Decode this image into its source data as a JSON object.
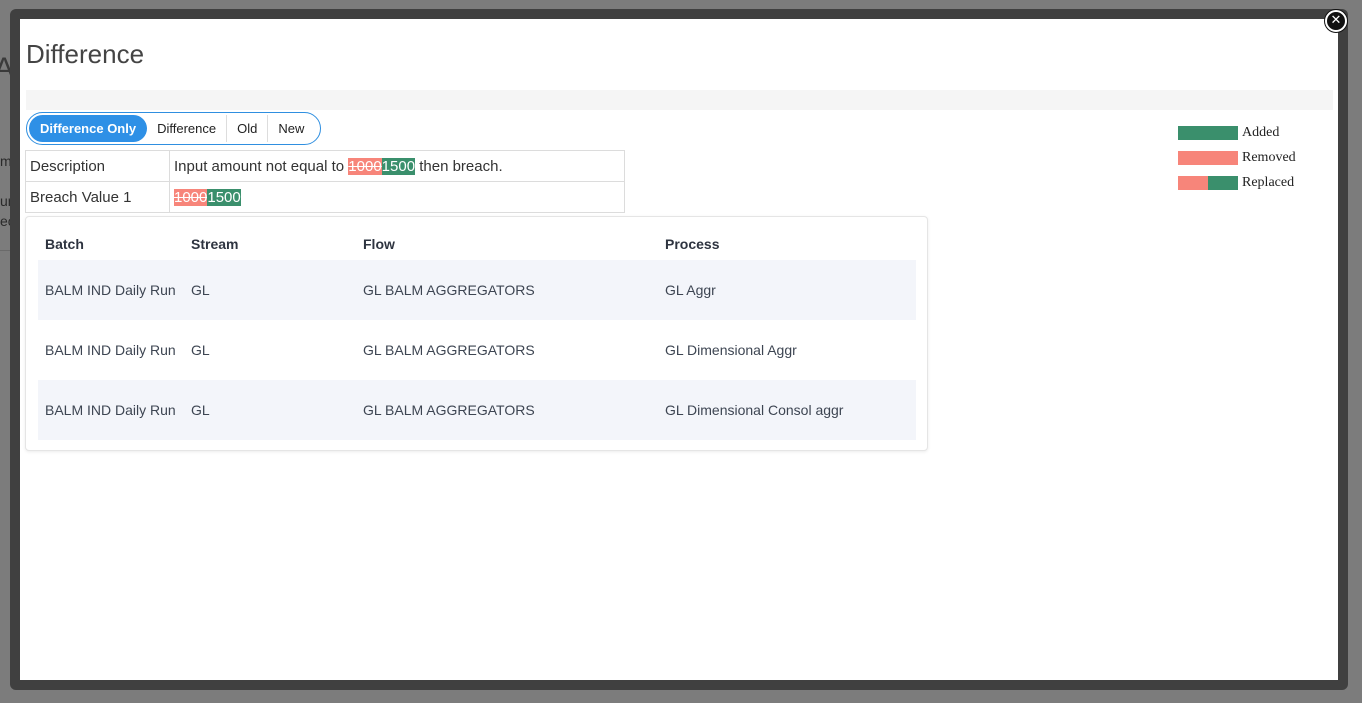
{
  "background": {
    "title": "Ap",
    "cells": [
      "me",
      "unt",
      "eck"
    ]
  },
  "modal": {
    "title": "Difference",
    "close_icon": "close-circle-icon"
  },
  "view_toggle": {
    "options": [
      "Difference Only",
      "Difference",
      "Old",
      "New"
    ],
    "selected": "Difference Only"
  },
  "diff": {
    "rows": [
      {
        "label": "Description",
        "prefix": "Input amount not equal to ",
        "removed": "1000",
        "added": "1500",
        "suffix": " then breach."
      },
      {
        "label": "Breach Value 1",
        "prefix": "",
        "removed": "1000",
        "added": "1500",
        "suffix": ""
      }
    ]
  },
  "batch_table": {
    "headers": [
      "Batch",
      "Stream",
      "Flow",
      "Process"
    ],
    "rows": [
      [
        "BALM IND Daily Run",
        "GL",
        "GL BALM AGGREGATORS",
        "GL Aggr"
      ],
      [
        "BALM IND Daily Run",
        "GL",
        "GL BALM AGGREGATORS",
        "GL Dimensional Aggr"
      ],
      [
        "BALM IND Daily Run",
        "GL",
        "GL BALM AGGREGATORS",
        "GL Dimensional Consol aggr"
      ]
    ]
  },
  "legend": {
    "added": "Added",
    "removed": "Removed",
    "replaced": "Replaced"
  },
  "colors": {
    "added": "#3a8f6c",
    "removed": "#f7857a",
    "accent": "#2e90e6"
  }
}
